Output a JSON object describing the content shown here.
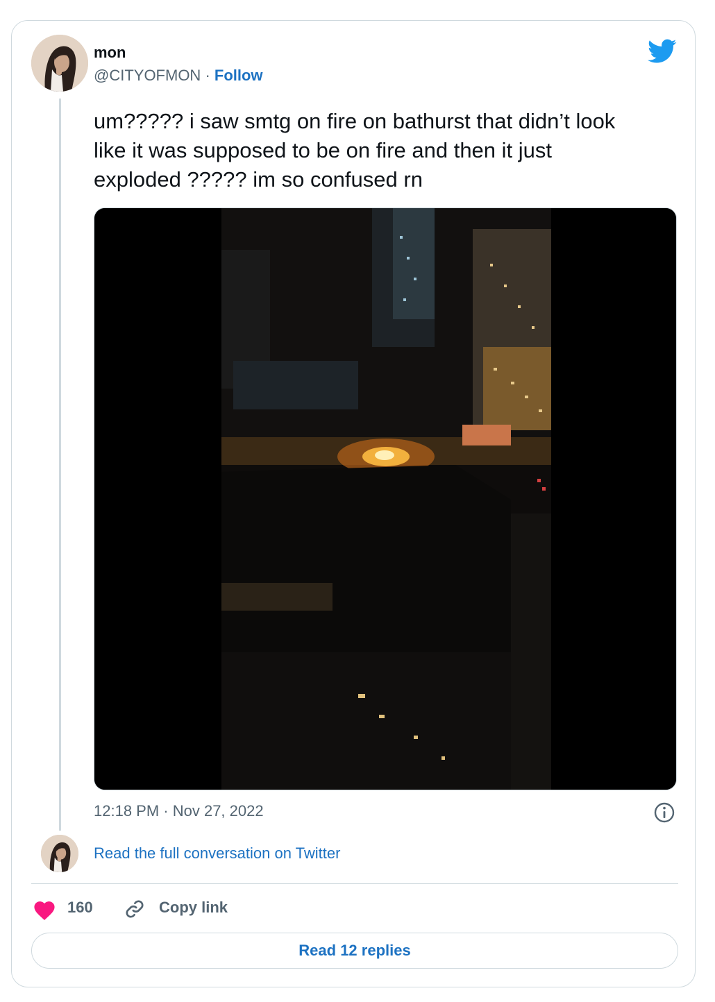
{
  "author": {
    "name": "mon",
    "handle": "@CITYOFMON",
    "separator": " · ",
    "follow_label": "Follow"
  },
  "tweet": {
    "text": "um????? i saw smtg on fire on bathurst that didn’t look\nlike it was supposed to be on fire and then it just\nexploded ????? im so confused rn",
    "timestamp": "12:18 PM · Nov 27, 2022"
  },
  "conversation": {
    "read_full_label": "Read the full conversation on Twitter"
  },
  "actions": {
    "like_count": "160",
    "copy_link_label": "Copy link",
    "read_replies_label": "Read 12 replies"
  },
  "icons": {
    "brand": "twitter-bird-icon",
    "info": "info-icon",
    "like": "heart-icon",
    "link": "link-icon"
  },
  "colors": {
    "link_blue": "#1d72c2",
    "twitter_blue": "#1d9bf0",
    "heart_red": "#f91880",
    "muted_text": "#536471",
    "border": "#cfd9de"
  }
}
